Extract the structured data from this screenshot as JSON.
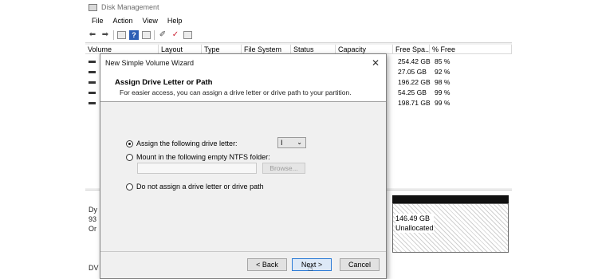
{
  "window": {
    "title": "Disk Management"
  },
  "menu": [
    "File",
    "Action",
    "View",
    "Help"
  ],
  "toolbar_icons": [
    "back-icon",
    "forward-icon",
    "properties-icon",
    "help-icon",
    "view-icon",
    "connect-icon",
    "check-icon",
    "list-icon"
  ],
  "grid": {
    "headers": [
      "Volume",
      "Layout",
      "Type",
      "File System",
      "Status",
      "Capacity",
      "Free Spa...",
      "% Free"
    ],
    "rows": [
      {
        "free": "254.42 GB",
        "pct": "85 %"
      },
      {
        "free": "27.05 GB",
        "pct": "92 %"
      },
      {
        "free": "196.22 GB",
        "pct": "98 %"
      },
      {
        "free": "54.25 GB",
        "pct": "99 %"
      },
      {
        "free": "198.71 GB",
        "pct": "99 %"
      }
    ]
  },
  "graph": {
    "disk_label_line1": "Dy",
    "disk_label_line2": "93",
    "disk_label_line3": "Or",
    "unallocated_size": "146.49 GB",
    "unallocated_label": "Unallocated",
    "dvd_label": "DV"
  },
  "wizard": {
    "title": "New Simple Volume Wizard",
    "heading": "Assign Drive Letter or Path",
    "subheading": "For easier access, you can assign a drive letter or drive path to your partition.",
    "options": {
      "assign_letter": "Assign the following drive letter:",
      "mount_folder": "Mount in the following empty NTFS folder:",
      "no_letter": "Do not assign a drive letter or drive path"
    },
    "selected_letter": "I",
    "browse_label": "Browse...",
    "back_label": "< Back",
    "next_label": "Next >",
    "cancel_label": "Cancel"
  }
}
